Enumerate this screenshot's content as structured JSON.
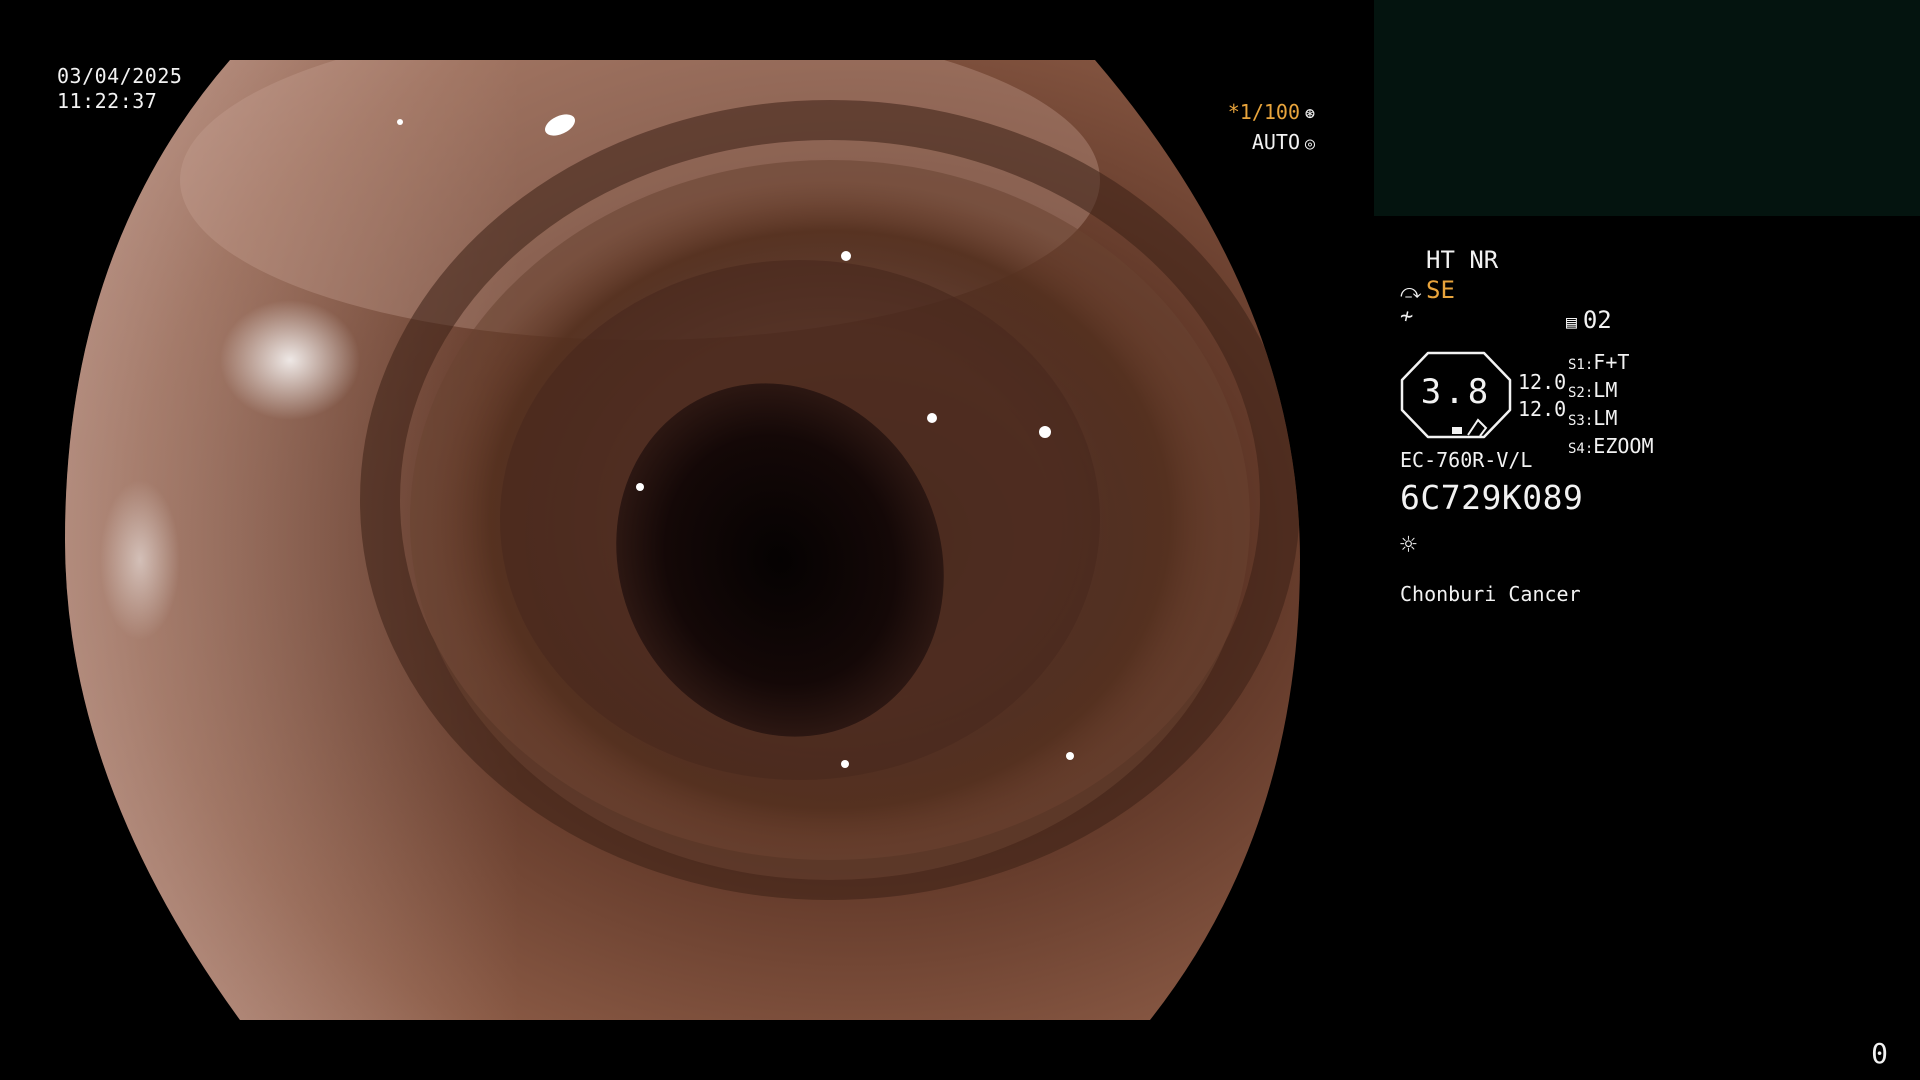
{
  "capture": {
    "date": "03/04/2025",
    "time": "11:22:37"
  },
  "shutter": {
    "speed": "*1/100",
    "speed_icon": "aperture-icon",
    "mode": "AUTO",
    "mode_icon": "iris-icon"
  },
  "processor": {
    "modes": "HT NR",
    "structure_enhance": "SE",
    "structure_enhance_icon": "enhance-icon",
    "color_icon": "color-curve-icon",
    "gain_icon": "gain-icon",
    "gain_level": "02"
  },
  "zoom": {
    "value": "3.8",
    "value_a": "12.0",
    "value_b": "12.0"
  },
  "scope_switches": [
    {
      "key": "S1:",
      "value": "F+T"
    },
    {
      "key": "S2:",
      "value": "LM"
    },
    {
      "key": "S3:",
      "value": "LM"
    },
    {
      "key": "S4:",
      "value": "EZOOM"
    }
  ],
  "scope": {
    "model": "EC-760R-V/L",
    "serial": "6C729K089"
  },
  "light_icon": "light-source-icon",
  "institution": "Chonburi Cancer",
  "image_counter": "0",
  "colors": {
    "accent": "#e8a43c",
    "text": "#f2f2f2",
    "preview_panel": "#04140f"
  }
}
